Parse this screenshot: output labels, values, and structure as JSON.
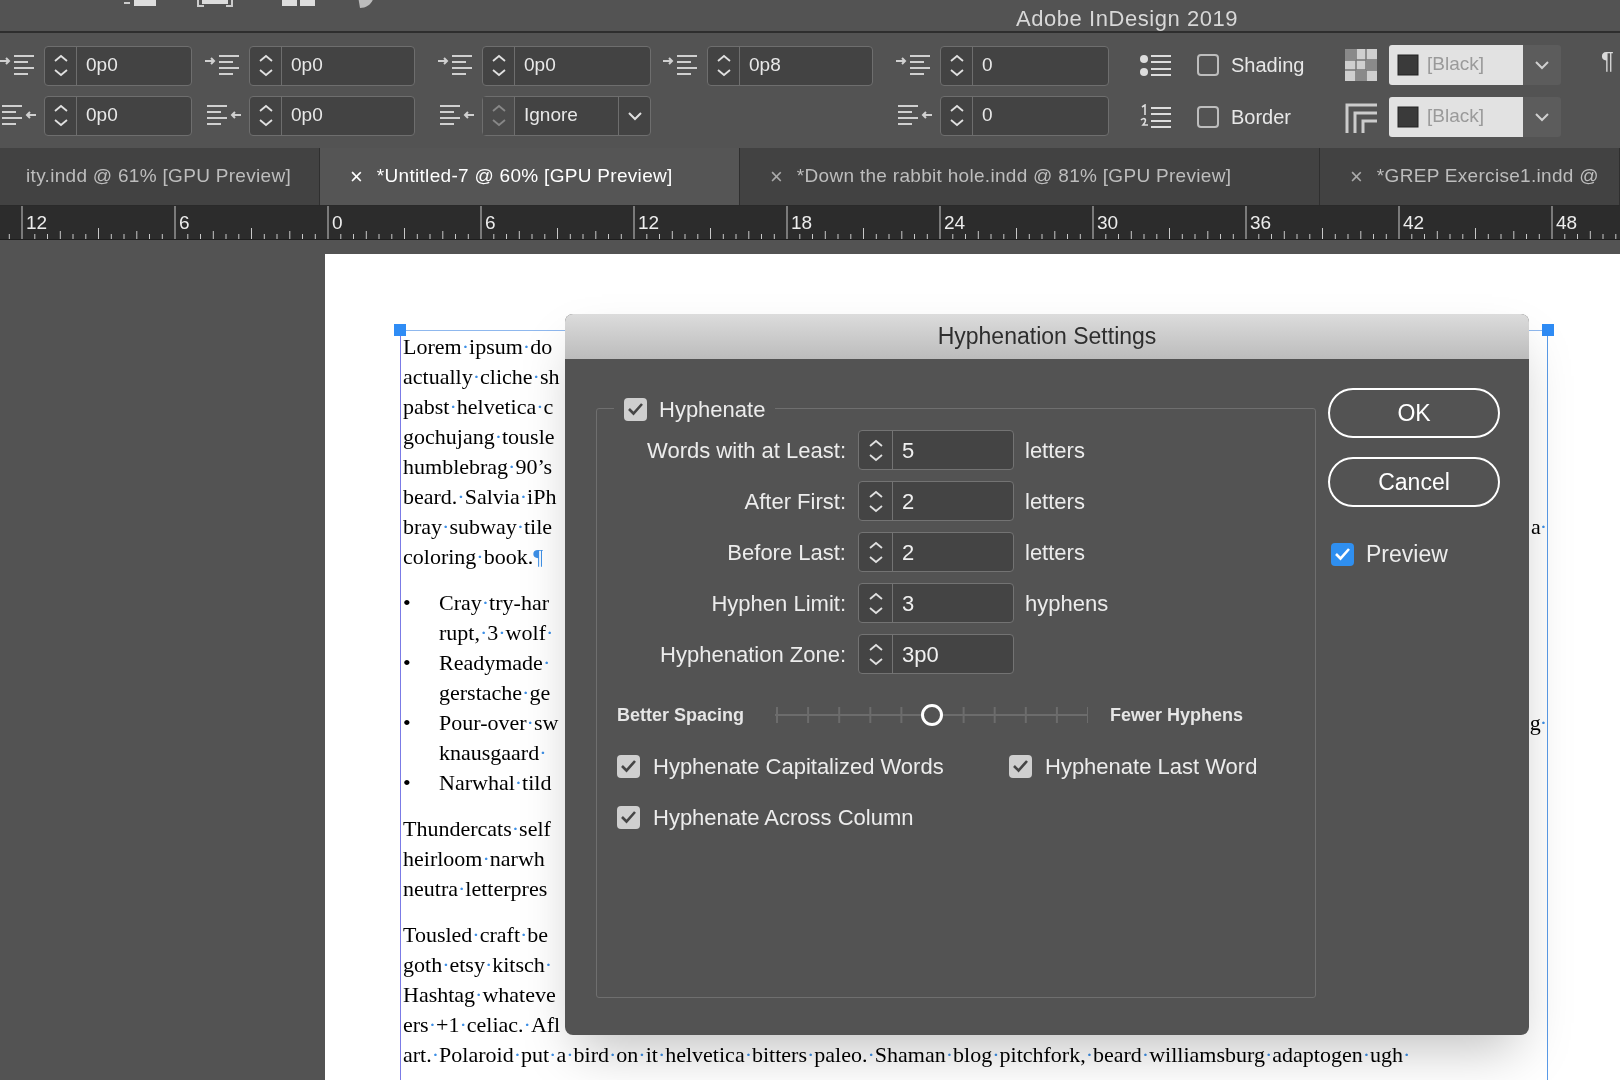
{
  "app_title": "Adobe InDesign 2019",
  "control_panel": {
    "columns": [
      {
        "top": {
          "kind": "spinner",
          "value": "0p0"
        },
        "bottom": {
          "kind": "spinner",
          "value": "0p0"
        }
      },
      {
        "top": {
          "kind": "spinner",
          "value": "0p0"
        },
        "bottom": {
          "kind": "spinner",
          "value": "0p0"
        }
      },
      {
        "top": {
          "kind": "spinner",
          "value": "0p0"
        },
        "bottom": {
          "kind": "dropdown",
          "value": "Ignore"
        }
      },
      {
        "top": {
          "kind": "spinner",
          "value": "0p8"
        }
      },
      {
        "top": {
          "kind": "spinner",
          "value": "0"
        },
        "bottom": {
          "kind": "spinner",
          "value": "0"
        }
      }
    ],
    "options": [
      {
        "label": "Shading",
        "checked": false,
        "swatch": "[Black]"
      },
      {
        "label": "Border",
        "checked": false,
        "swatch": "[Black]"
      }
    ],
    "pilcrow": "¶"
  },
  "tabs": [
    {
      "label": "ity.indd @ 61% [GPU Preview]",
      "selected": false
    },
    {
      "close": "×",
      "label": "*Untitled-7 @ 60% [GPU Preview]",
      "selected": true
    },
    {
      "close": "×",
      "label": "*Down the rabbit hole.indd @ 81% [GPU Preview]",
      "selected": false
    },
    {
      "close": "×",
      "label": "*GREP Exercise1.indd @",
      "selected": false
    }
  ],
  "ruler": {
    "labels": [
      "12",
      "6",
      "0",
      "6",
      "12",
      "18",
      "24",
      "30",
      "36",
      "42",
      "48"
    ]
  },
  "document": {
    "blocks": [
      {
        "kind": "paragraph",
        "lines": [
          {
            "text": "Lorem·ipsum·do"
          },
          {
            "text": "actually·cliche·sh"
          },
          {
            "text": "pabst·helvetica·c"
          },
          {
            "text": "gochujang·tousle"
          },
          {
            "text": "humblebrag·90’s"
          },
          {
            "text": "beard.·Salvia·iPh"
          },
          {
            "text": "bray·subway·tile",
            "end": "a·"
          },
          {
            "text": "coloring·book.¶"
          }
        ]
      },
      {
        "kind": "list",
        "items": [
          {
            "bullet": "•",
            "lines": [
              {
                "text": "Cray·try-har"
              },
              {
                "text": "rupt,·3·wolf·"
              }
            ]
          },
          {
            "bullet": "•",
            "lines": [
              {
                "text": "Readymade·"
              },
              {
                "text": "gerstache·ge"
              }
            ]
          },
          {
            "bullet": "•",
            "lines": [
              {
                "text": "Pour-over·sw",
                "end": "g·"
              },
              {
                "text": "knausgaard·"
              }
            ]
          },
          {
            "bullet": "•",
            "lines": [
              {
                "text": "Narwhal·tild"
              }
            ]
          }
        ]
      },
      {
        "kind": "paragraph",
        "lines": [
          {
            "text": "Thundercats·self"
          },
          {
            "text": "heirloom·narwh"
          },
          {
            "text": "neutra·letterpres"
          }
        ]
      },
      {
        "kind": "paragraph",
        "lines": [
          {
            "text": "Tousled·craft·be"
          },
          {
            "text": "goth·etsy·kitsch·"
          },
          {
            "text": "Hashtag·whateve"
          },
          {
            "text": "ers·+1·celiac.·Afl"
          },
          {
            "text": "art.·Polaroid·put·a·bird·on·it·helvetica·bitters·paleo.·Shaman·blog·pitchfork,·beard·williamsburg·adaptogen·ugh·"
          }
        ]
      }
    ]
  },
  "dialog": {
    "title": "Hyphenation Settings",
    "hyphenate": {
      "label": "Hyphenate",
      "checked": true
    },
    "fields": [
      {
        "label": "Words with at Least:",
        "value": "5",
        "unit": "letters"
      },
      {
        "label": "After First:",
        "value": "2",
        "unit": "letters"
      },
      {
        "label": "Before Last:",
        "value": "2",
        "unit": "letters"
      },
      {
        "label": "Hyphen Limit:",
        "value": "3",
        "unit": "hyphens"
      },
      {
        "label": "Hyphenation Zone:",
        "value": "3p0"
      }
    ],
    "slider": {
      "left_label": "Better Spacing",
      "right_label": "Fewer Hyphens",
      "level": 0.5
    },
    "options": [
      {
        "label": "Hyphenate Capitalized Words",
        "checked": true
      },
      {
        "label": "Hyphenate Last Word",
        "checked": true
      },
      {
        "label": "Hyphenate Across Column",
        "checked": true
      }
    ],
    "buttons": [
      "OK",
      "Cancel"
    ],
    "preview": {
      "label": "Preview",
      "checked": true
    }
  }
}
